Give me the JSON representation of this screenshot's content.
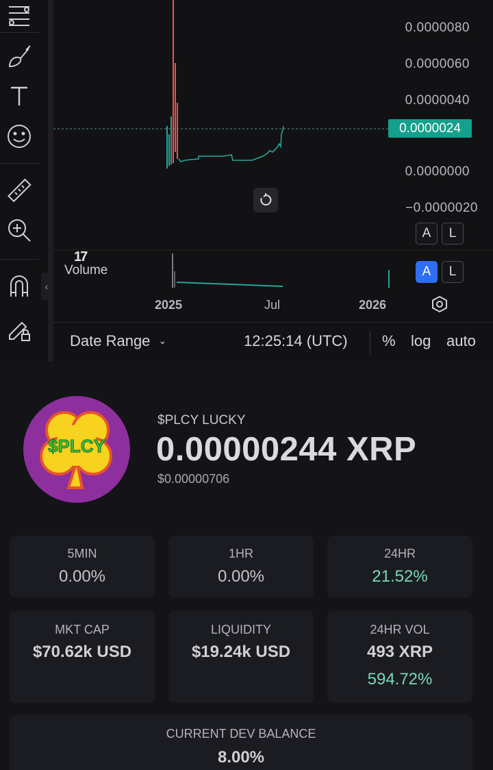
{
  "chart": {
    "y_ticks": [
      "0.0000080",
      "0.0000060",
      "0.0000040",
      "0.0000000",
      "−0.0000020"
    ],
    "current_price_tag": "0.0000024",
    "price_scale_buttons": [
      "A",
      "L"
    ],
    "volume_scale_buttons": [
      "A",
      "L"
    ],
    "volume_label": "Volume",
    "tradingview_mark": "17",
    "x_ticks": [
      "2025",
      "Jul",
      "2026"
    ],
    "bottom_bar": {
      "date_range": "Date Range",
      "time": "12:25:14 (UTC)",
      "percent": "%",
      "log": "log",
      "auto": "auto"
    },
    "colors": {
      "up": "#26a69a",
      "down": "#ef5350",
      "price_tag": "#15a08c",
      "active_button": "#2f6df2"
    },
    "toolbar_icons": [
      "fib-tools-icon",
      "brush-icon",
      "text-icon",
      "emoji-icon",
      "ruler-icon",
      "zoom-in-icon",
      "magnet-icon",
      "lock-drawing-icon"
    ]
  },
  "token": {
    "logo_text": "$PLCY",
    "name": "$PLCY LUCKY",
    "price": "0.00000244 XRP",
    "usd_price": "$0.00000706"
  },
  "stats": {
    "min5": {
      "label": "5MIN",
      "value": "0.00%"
    },
    "hr1": {
      "label": "1HR",
      "value": "0.00%"
    },
    "hr24": {
      "label": "24HR",
      "value": "21.52%"
    },
    "mkt_cap": {
      "label": "MKT CAP",
      "value": "$70.62k USD"
    },
    "liquidity": {
      "label": "LIQUIDITY",
      "value": "$19.24k USD"
    },
    "vol24": {
      "label": "24HR VOL",
      "value": "493 XRP",
      "change": "594.72%"
    },
    "dev_balance": {
      "label": "CURRENT DEV BALANCE",
      "value": "8.00%"
    }
  }
}
